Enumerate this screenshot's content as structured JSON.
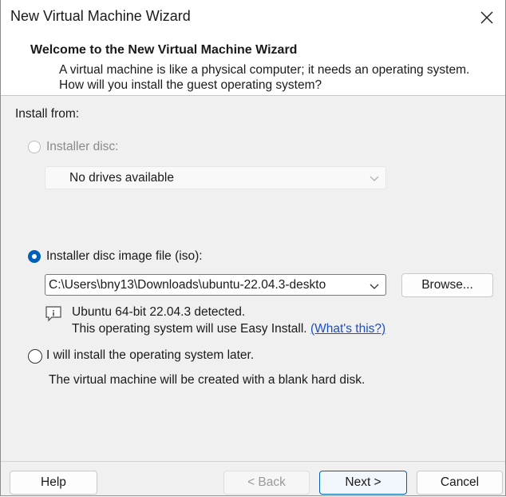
{
  "window": {
    "title": "New Virtual Machine Wizard"
  },
  "header": {
    "title": "Welcome to the New Virtual Machine Wizard",
    "description": "A virtual machine is like a physical computer; it needs an operating system. How will you install the guest operating system?"
  },
  "install": {
    "section_label": "Install from:",
    "disc": {
      "label": "Installer disc:",
      "selected": false,
      "enabled": false,
      "dropdown_value": "No drives available"
    },
    "iso": {
      "label": "Installer disc image file (iso):",
      "selected": true,
      "path_value": "C:\\Users\\bny13\\Downloads\\ubuntu-22.04.3-deskto",
      "browse_label": "Browse...",
      "detected_text": "Ubuntu 64-bit 22.04.3 detected.",
      "easy_install_text": "This operating system will use Easy Install.",
      "whats_this_link": "(What's this?)"
    },
    "later": {
      "label": "I will install the operating system later.",
      "selected": false,
      "note": "The virtual machine will be created with a blank hard disk."
    }
  },
  "footer": {
    "help_label": "Help",
    "back_label": "< Back",
    "next_label": "Next >",
    "cancel_label": "Cancel"
  },
  "colors": {
    "accent": "#005fb8",
    "link": "#1a4fc4",
    "disabled_text": "#8a8a8a"
  },
  "icons": {
    "close": "close-icon",
    "dropdown": "chevron-down-icon",
    "info": "info-comment-icon"
  }
}
